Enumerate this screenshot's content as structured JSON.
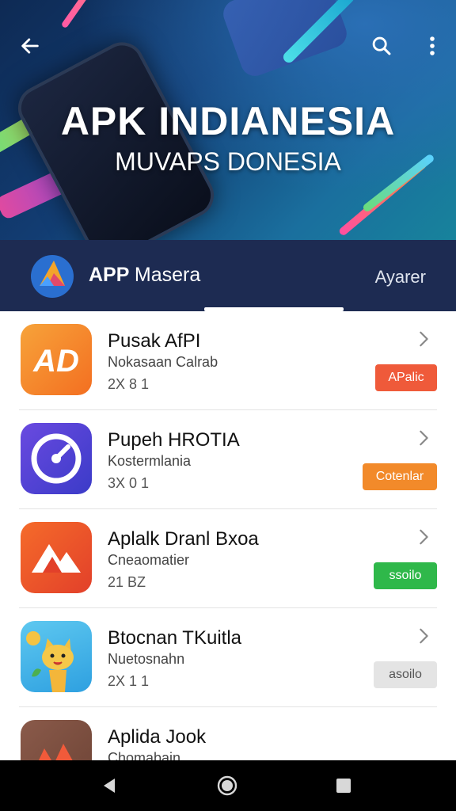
{
  "header": {
    "banner_title": "APK INDIANESIA",
    "banner_subtitle": "MUVAPS DONESIA",
    "back_icon": "arrow-left-icon",
    "search_icon": "search-icon",
    "menu_icon": "more-vertical-icon"
  },
  "tabbar": {
    "brand_bold": "APP",
    "brand_light": "Masera",
    "right_label": "Ayarer"
  },
  "apps": [
    {
      "title": "Pusak AfPI",
      "subtitle": "Nokasaan Calrab",
      "meta": "2X 8 1",
      "badge": "APalic",
      "badge_color": "#ef5a3a",
      "icon": "ad-app-icon"
    },
    {
      "title": "Pupeh HROTIA",
      "subtitle": "Kostermlania",
      "meta": "3X 0 1",
      "badge": "Cotenlar",
      "badge_color": "#f28a2a",
      "icon": "dial-app-icon"
    },
    {
      "title": "Aplalk Dranl Bxoa",
      "subtitle": "Cneaomatier",
      "meta": "21 BZ",
      "badge": "ssoilo",
      "badge_color": "#2fb84a",
      "icon": "mountain-app-icon"
    },
    {
      "title": "Btocnan TKuitla",
      "subtitle": "Nuetosnahn",
      "meta": "2X 1 1",
      "badge": "asoilo",
      "badge_color": "#e4e4e4",
      "icon": "cat-app-icon"
    },
    {
      "title": "Aplida Jook",
      "subtitle": "Chomabain",
      "meta": "",
      "badge": "",
      "badge_color": "",
      "icon": "red-peak-app-icon"
    }
  ],
  "colors": {
    "tabbar_bg": "#1d2b52",
    "accent_orange": "#f36f21"
  }
}
